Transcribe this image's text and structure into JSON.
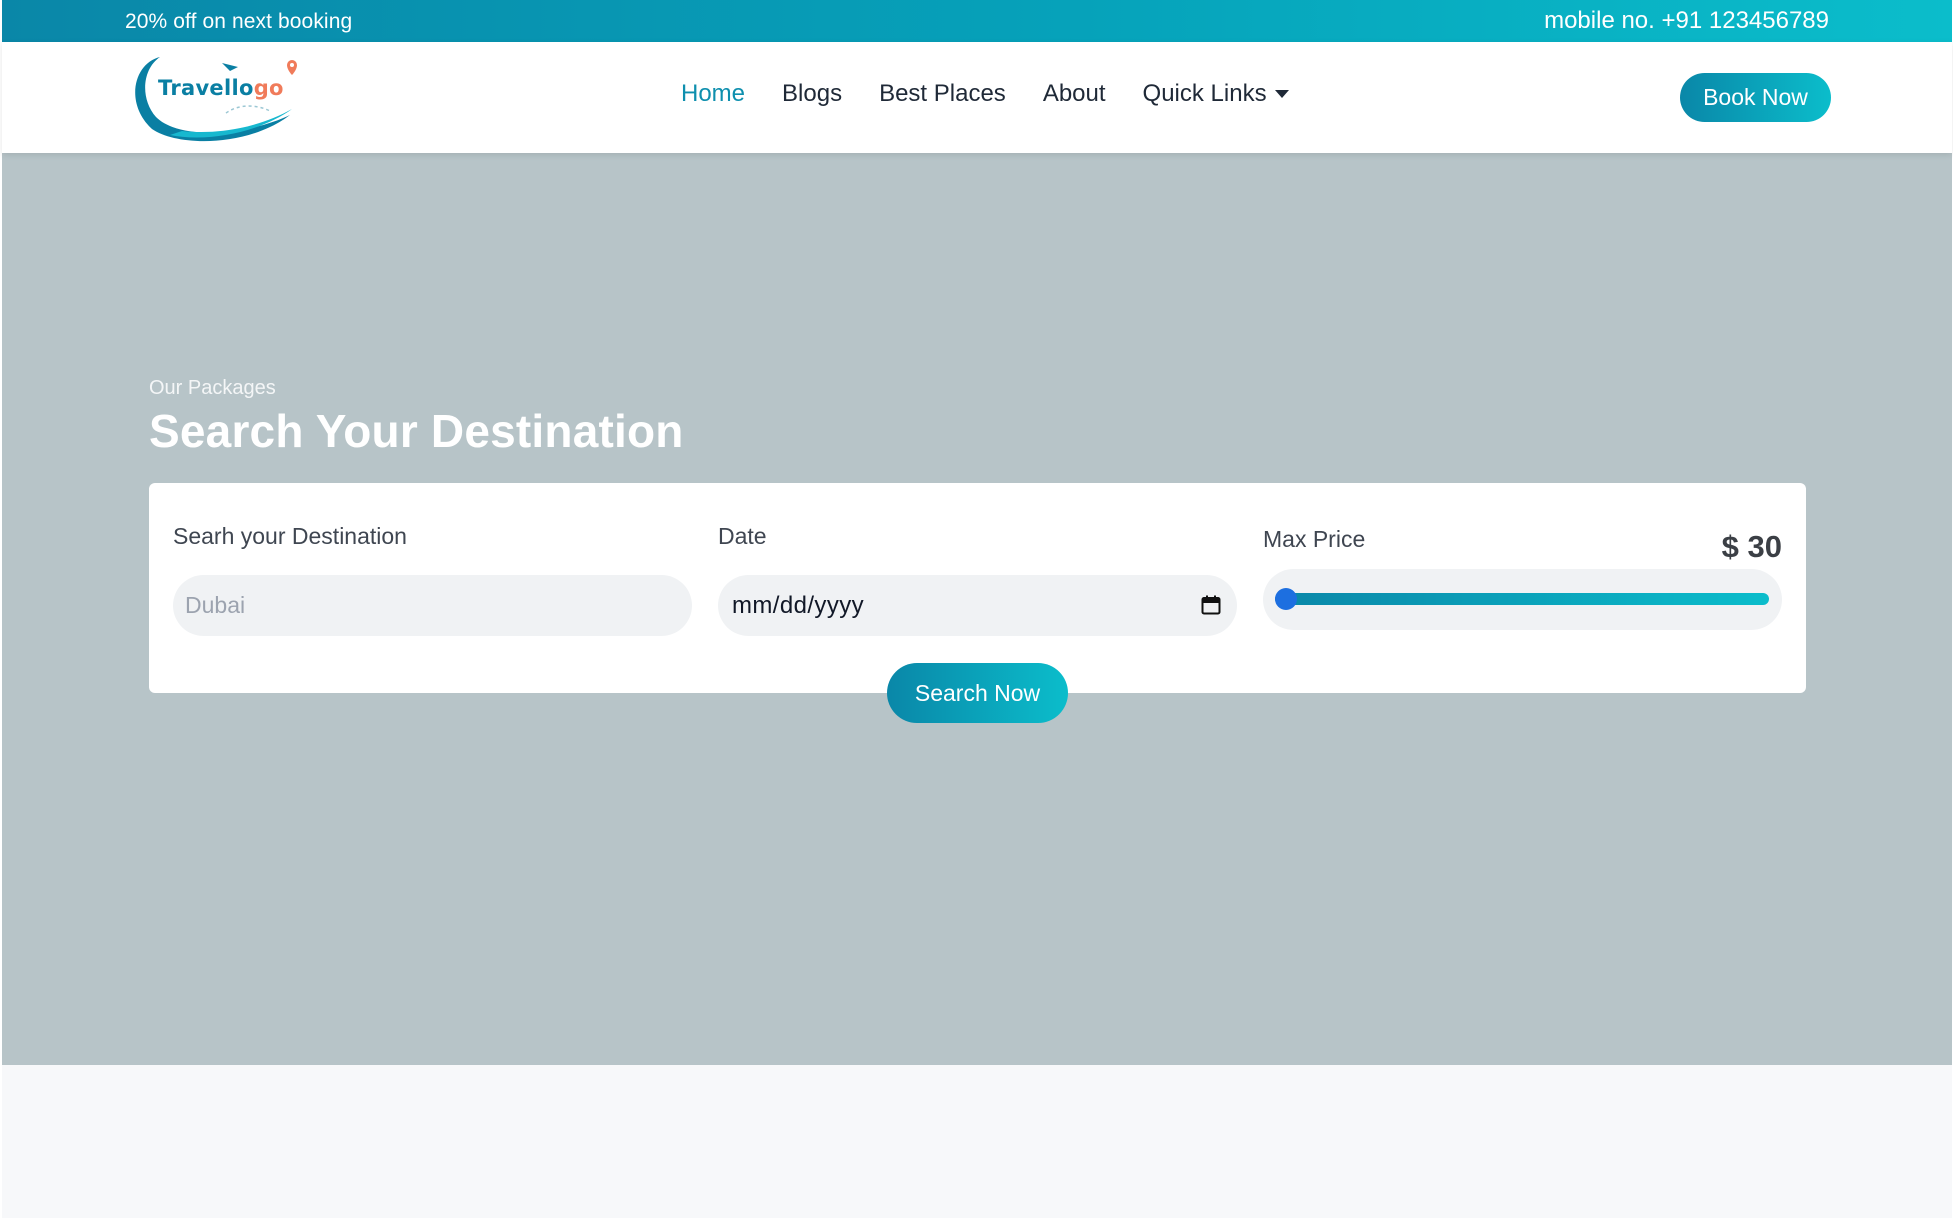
{
  "topbar": {
    "promo_text": "20% off on next booking",
    "phone_text": "mobile no. +91 123456789"
  },
  "logo": {
    "name_main": "Travello",
    "name_accent": "go",
    "mark": "!"
  },
  "nav": {
    "items": [
      {
        "label": "Home",
        "active": true
      },
      {
        "label": "Blogs",
        "active": false
      },
      {
        "label": "Best Places",
        "active": false
      },
      {
        "label": "About",
        "active": false
      },
      {
        "label": "Quick Links",
        "active": false,
        "dropdown": true
      }
    ],
    "book_button": "Book Now"
  },
  "hero": {
    "eyebrow": "Our Packages",
    "headline": "Search Your Destination"
  },
  "search_form": {
    "destination_label": "Searh your Destination",
    "destination_placeholder": "Dubai",
    "date_label": "Date",
    "date_placeholder": "mm/dd/yyyy",
    "price_label": "Max Price",
    "price_value_text": "$ 30",
    "price_slider_fraction": 0.0,
    "search_button": "Search Now"
  },
  "colors": {
    "brand_start": "#0a87a8",
    "brand_end": "#0bbdcb",
    "nav_active": "#0e8fae",
    "hero_bg": "#b7c4c8",
    "slider_thumb": "#1d6fe0",
    "logo_accent": "#f07b5a"
  },
  "icons": {
    "calendar": "calendar-icon",
    "caret": "caret-down-icon",
    "logo": "travel-logo-icon"
  }
}
